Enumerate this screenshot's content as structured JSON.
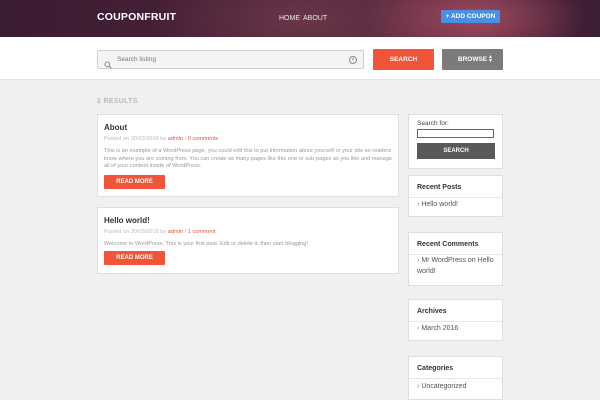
{
  "header": {
    "logo": "COUPONFRUIT",
    "nav": [
      "HOME",
      "ABOUT"
    ],
    "add_button": "+ ADD COUPON"
  },
  "search": {
    "placeholder": "Search listing",
    "search_button": "SEARCH",
    "browse_button": "BROWSE"
  },
  "results": {
    "count_label": "2 RESULTS"
  },
  "posts": [
    {
      "title": "About",
      "posted_on": "Posted on 30/03/2016 by",
      "author": "admin",
      "sep": " / ",
      "comments": "0 comments",
      "excerpt": "This is an example of a WordPress page, you could edit this to put information about yourself or your site so readers know where you are coming from. You can create as many pages like this one or sub-pages as you like and manage all of your content inside of WordPress.",
      "read_more": "READ MORE"
    },
    {
      "title": "Hello world!",
      "posted_on": "Posted on 30/03/2016 by",
      "author": "admin",
      "sep": " / ",
      "comments": "1 comment",
      "excerpt": "Welcome to WordPress. This is your first post. Edit or delete it, then start blogging!",
      "read_more": "READ MORE"
    }
  ],
  "sidebar": {
    "search_label": "Search for:",
    "search_button": "SEARCH",
    "recent_posts": {
      "title": "Recent Posts",
      "items": [
        "Hello world!"
      ]
    },
    "recent_comments": {
      "title": "Recent Comments",
      "author": "Mr WordPress",
      "on": " on ",
      "post": "Hello world!"
    },
    "archives": {
      "title": "Archives",
      "items": [
        "March 2016"
      ]
    },
    "categories": {
      "title": "Categories",
      "items": [
        "Uncategorized"
      ]
    }
  },
  "colors": {
    "accent": "#f15438",
    "add_button": "#4a90e2",
    "browse": "#7b7b7b",
    "header_dark": "#3a1c33"
  }
}
